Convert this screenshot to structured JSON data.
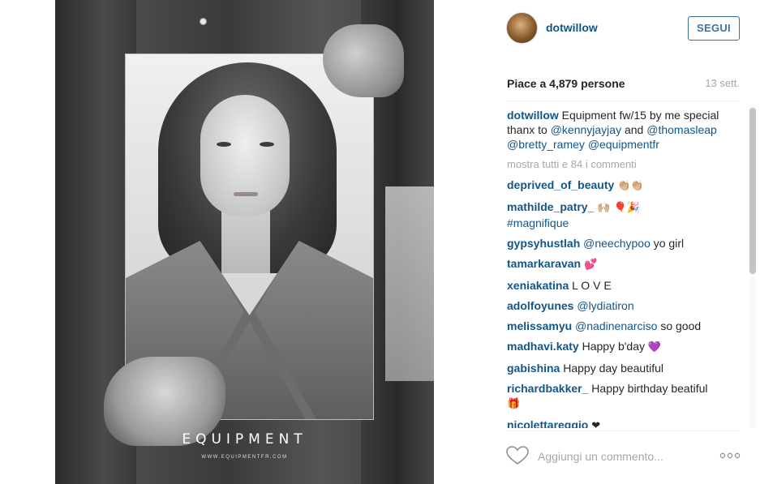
{
  "post": {
    "brand_wordmark": "EQUIPMENT",
    "brand_url": "WWW.EQUIPMENTFR.COM"
  },
  "header": {
    "username": "dotwillow",
    "follow_label": "SEGUI"
  },
  "stats": {
    "likes_text": "Piace a 4,879 persone",
    "time_ago": "13 sett."
  },
  "caption": {
    "username": "dotwillow",
    "text": "Equipment fw/15 by me special thanx to",
    "mention_1": "@kennyjayjay",
    "and_word": "and",
    "mention_2": "@thomasleap",
    "mention_3": "@bretty_ramey",
    "mention_4": "@equipmentfr"
  },
  "more_comments": "mostra tutti e 84 i commenti",
  "comments": [
    {
      "user": "deprived_of_beauty",
      "text": "",
      "emoji": "👏🏼👏🏼"
    },
    {
      "user": "mathilde_patry_",
      "text": "",
      "emoji": "🙌🏼      🎈🎉",
      "tag": "#magnifique"
    },
    {
      "user": "gypsyhustlah",
      "mention": "@neechypoo",
      "text": " yo girl"
    },
    {
      "user": "tamarkaravan",
      "text": "",
      "emoji": "💕"
    },
    {
      "user": "xeniakatina",
      "text": " L O V E"
    },
    {
      "user": "adolfoyunes",
      "mention": "@lydiatiron",
      "text": ""
    },
    {
      "user": "melissamyu",
      "mention": "@nadinenarciso",
      "text": " so good"
    },
    {
      "user": "madhavi.katy",
      "text": " Happy b'day ",
      "emoji": "💜"
    },
    {
      "user": "gabishina",
      "text": " Happy day beautiful"
    },
    {
      "user": "richardbakker_",
      "text": " Happy birthday beatiful",
      "emoji": "🎁"
    },
    {
      "user": "nicolettareggio",
      "text": " ",
      "emoji": "❤"
    }
  ],
  "footer": {
    "comment_placeholder": "Aggiungi un commento...",
    "heart_icon": "heart-outline-icon",
    "more_icon": "more-options-icon"
  },
  "colors": {
    "link_blue": "#125688",
    "follow_border": "#3f729b",
    "muted_gray": "#a5a7aa"
  }
}
